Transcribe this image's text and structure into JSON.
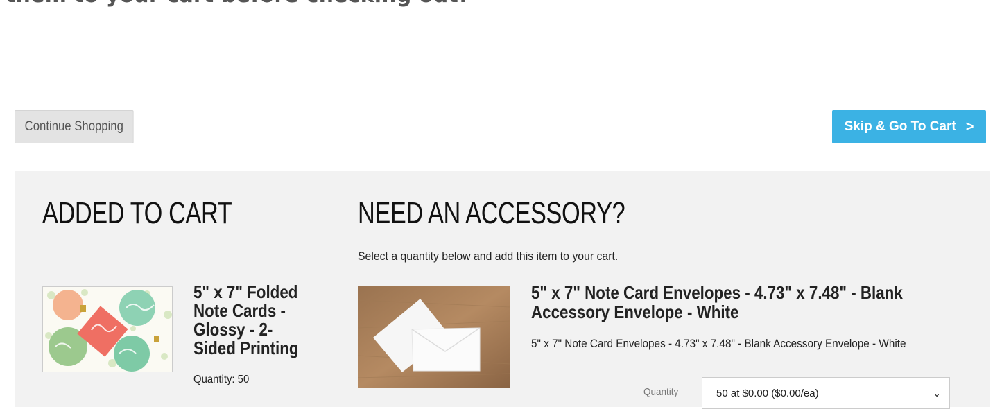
{
  "intro_text": "them to your cart before checking out!",
  "buttons": {
    "continue_label": "Continue Shopping",
    "skip_label": "Skip & Go To Cart"
  },
  "added": {
    "heading": "ADDED TO CART",
    "product_title": "5\" x 7\" Folded Note Cards - Glossy - 2-Sided Printing",
    "quantity_text": "Quantity: 50"
  },
  "accessory": {
    "heading": "NEED AN ACCESSORY?",
    "subtext": "Select a quantity below and add this item to your cart.",
    "title": "5\" x 7\" Note Card Envelopes - 4.73\" x 7.48\" - Blank Accessory Envelope - White",
    "description": "5\" x 7\" Note Card Envelopes - 4.73\" x 7.48\" - Blank Accessory Envelope - White",
    "quantity_label": "Quantity",
    "quantity_selected": "50 at $0.00 ($0.00/ea)"
  },
  "colors": {
    "skip_button": "#3bb2e4",
    "continue_button": "#e3e3e3",
    "panel": "#f2f2f2"
  },
  "icons": {
    "skip_chevron": "chevron-right-icon",
    "select_chevron": "chevron-down-icon"
  }
}
